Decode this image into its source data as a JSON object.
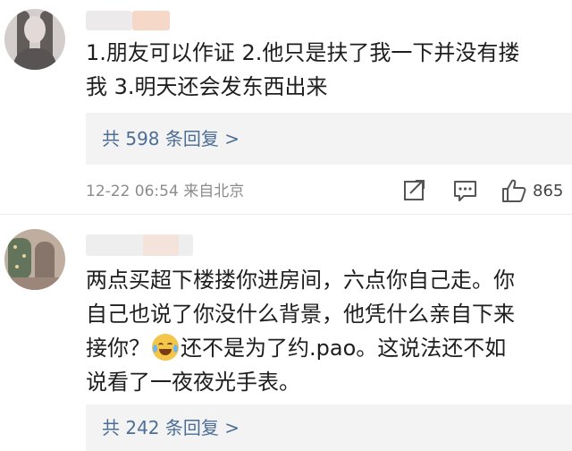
{
  "comments": [
    {
      "text_line1": "1.朋友可以作证 2.他只是扶了我一下并没有搂",
      "text_line2": "我 3.明天还会发东西出来",
      "replies_label": "共 598 条回复 >",
      "timestamp": "12-22 06:54",
      "location": "来自北京",
      "like_count": "865"
    },
    {
      "text_line1": "两点买超下楼搂你进房间，六点你自己走。你",
      "text_line2": "自己也说了你没什么背景，他凭什么亲自下来",
      "text_line3a": "接你？",
      "text_line3b": "还不是为了约.pao。这说法还不如",
      "text_line4": "说看了一夜夜光手表。",
      "replies_label": "共 242 条回复 >"
    }
  ],
  "icons": {
    "share": "share-icon",
    "comment": "comment-icon",
    "like": "thumbs-up-icon",
    "emoji": "laugh-cry-emoji-icon"
  },
  "colors": {
    "link": "#4d6e95",
    "meta": "#8c8c8c",
    "reply_bg": "#f3f3f3"
  }
}
